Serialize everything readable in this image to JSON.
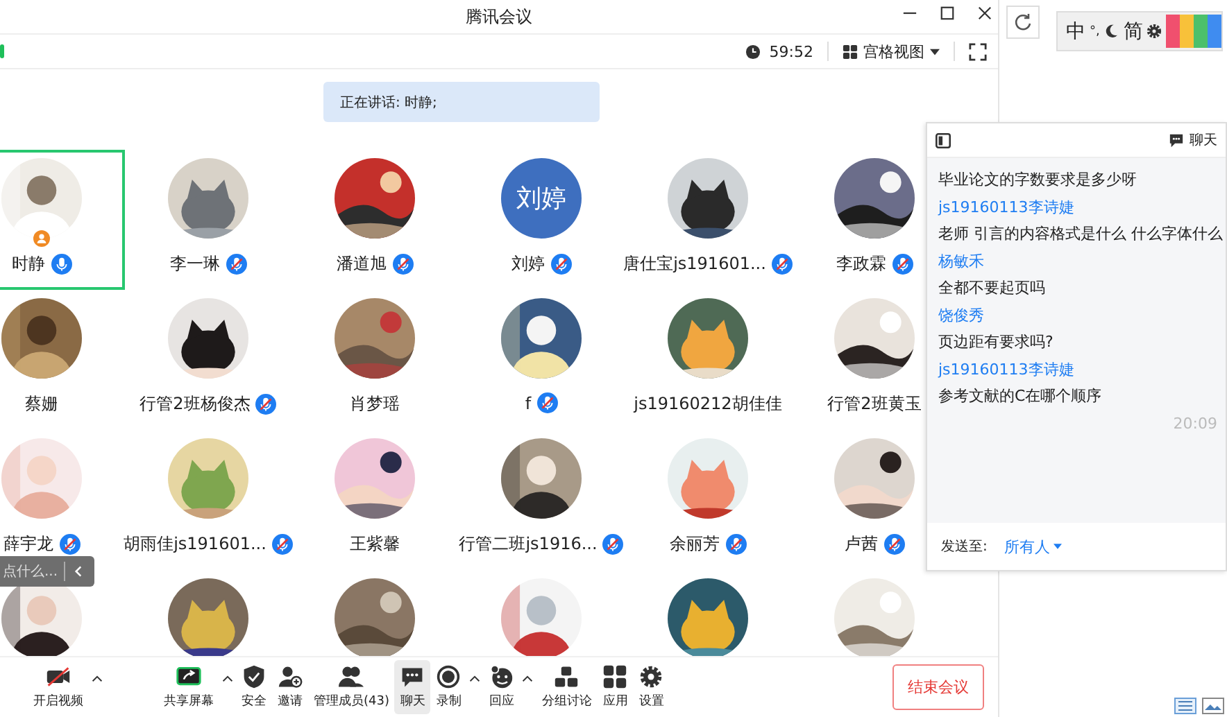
{
  "window": {
    "title": "腾讯会议"
  },
  "controls": {
    "timer": "59:52",
    "view": "宫格视图"
  },
  "speaking": "正在讲话: 时静;",
  "participants": [
    {
      "name": "时静",
      "muted": false,
      "selected": true,
      "host": true
    },
    {
      "name": "李一琳",
      "muted": true,
      "selected": false,
      "host": false
    },
    {
      "name": "潘道旭",
      "muted": true,
      "selected": false,
      "host": false
    },
    {
      "name": "刘婷",
      "muted": true,
      "selected": false,
      "host": false,
      "avatar": {
        "kind": "initials",
        "text": "刘婷"
      }
    },
    {
      "name": "唐仕宝js191601...",
      "muted": true,
      "selected": false,
      "host": false
    },
    {
      "name": "李政霖",
      "muted": true,
      "selected": false,
      "host": false
    },
    {
      "name": "蔡姗",
      "selected": false,
      "host": false
    },
    {
      "name": "行管2班杨俊杰",
      "muted": true,
      "selected": false,
      "host": false
    },
    {
      "name": "肖梦瑶",
      "selected": false,
      "host": false
    },
    {
      "name": "f",
      "muted": true,
      "selected": false,
      "host": false
    },
    {
      "name": "js19160212胡佳佳",
      "selected": false,
      "host": false
    },
    {
      "name": "行管2班黄玉",
      "selected": false,
      "host": false
    },
    {
      "name": "薛宇龙",
      "muted": true,
      "selected": false,
      "host": false
    },
    {
      "name": "胡雨佳js191601...",
      "muted": true,
      "selected": false,
      "host": false
    },
    {
      "name": "王紫馨",
      "selected": false,
      "host": false
    },
    {
      "name": "行管二班js1916...",
      "muted": true,
      "selected": false,
      "host": false
    },
    {
      "name": "余丽芳",
      "muted": true,
      "selected": false,
      "host": false
    },
    {
      "name": "卢茜",
      "muted": true,
      "selected": false,
      "host": false
    },
    {
      "selected": false,
      "host": false
    },
    {
      "selected": false,
      "host": false
    },
    {
      "selected": false,
      "host": false
    },
    {
      "selected": false,
      "host": false
    },
    {
      "selected": false,
      "host": false
    },
    {
      "selected": false,
      "host": false
    }
  ],
  "chat_input": {
    "placeholder": "点什么..."
  },
  "chat": {
    "title": "聊天",
    "lines": [
      {
        "kind": "text",
        "text": "毕业论文的字数要求是多少呀"
      },
      {
        "kind": "sender",
        "text": "js19160113李诗婕"
      },
      {
        "kind": "text",
        "text": "老师 引言的内容格式是什么 什么字体什么"
      },
      {
        "kind": "sender",
        "text": "杨敏禾"
      },
      {
        "kind": "text",
        "text": "全都不要起页吗"
      },
      {
        "kind": "sender",
        "text": "饶俊秀"
      },
      {
        "kind": "text",
        "text": "页边距有要求吗?"
      },
      {
        "kind": "sender",
        "text": "js19160113李诗婕"
      },
      {
        "kind": "text",
        "text": "参考文献的C在哪个顺序"
      },
      {
        "kind": "time",
        "text": "20:09"
      }
    ],
    "send_to_label": "发送至:",
    "send_to": "所有人"
  },
  "toolbar": [
    {
      "label": "开启视频",
      "selected": false,
      "caret": true
    },
    {
      "label": "共享屏幕",
      "selected": false,
      "caret": true
    },
    {
      "label": "安全",
      "selected": false,
      "caret": false
    },
    {
      "label": "邀请",
      "selected": false,
      "caret": false
    },
    {
      "label": "管理成员(43)",
      "selected": false,
      "caret": false
    },
    {
      "label": "聊天",
      "selected": true,
      "caret": false
    },
    {
      "label": "录制",
      "selected": false,
      "caret": true
    },
    {
      "label": "回应",
      "selected": false,
      "caret": true
    },
    {
      "label": "分组讨论",
      "selected": false,
      "caret": false
    },
    {
      "label": "应用",
      "selected": false,
      "caret": false
    },
    {
      "label": "设置",
      "selected": false,
      "caret": false
    }
  ],
  "end_button": "结束会议",
  "ime": {
    "lang": "中",
    "punct": "°,",
    "script": "简"
  }
}
